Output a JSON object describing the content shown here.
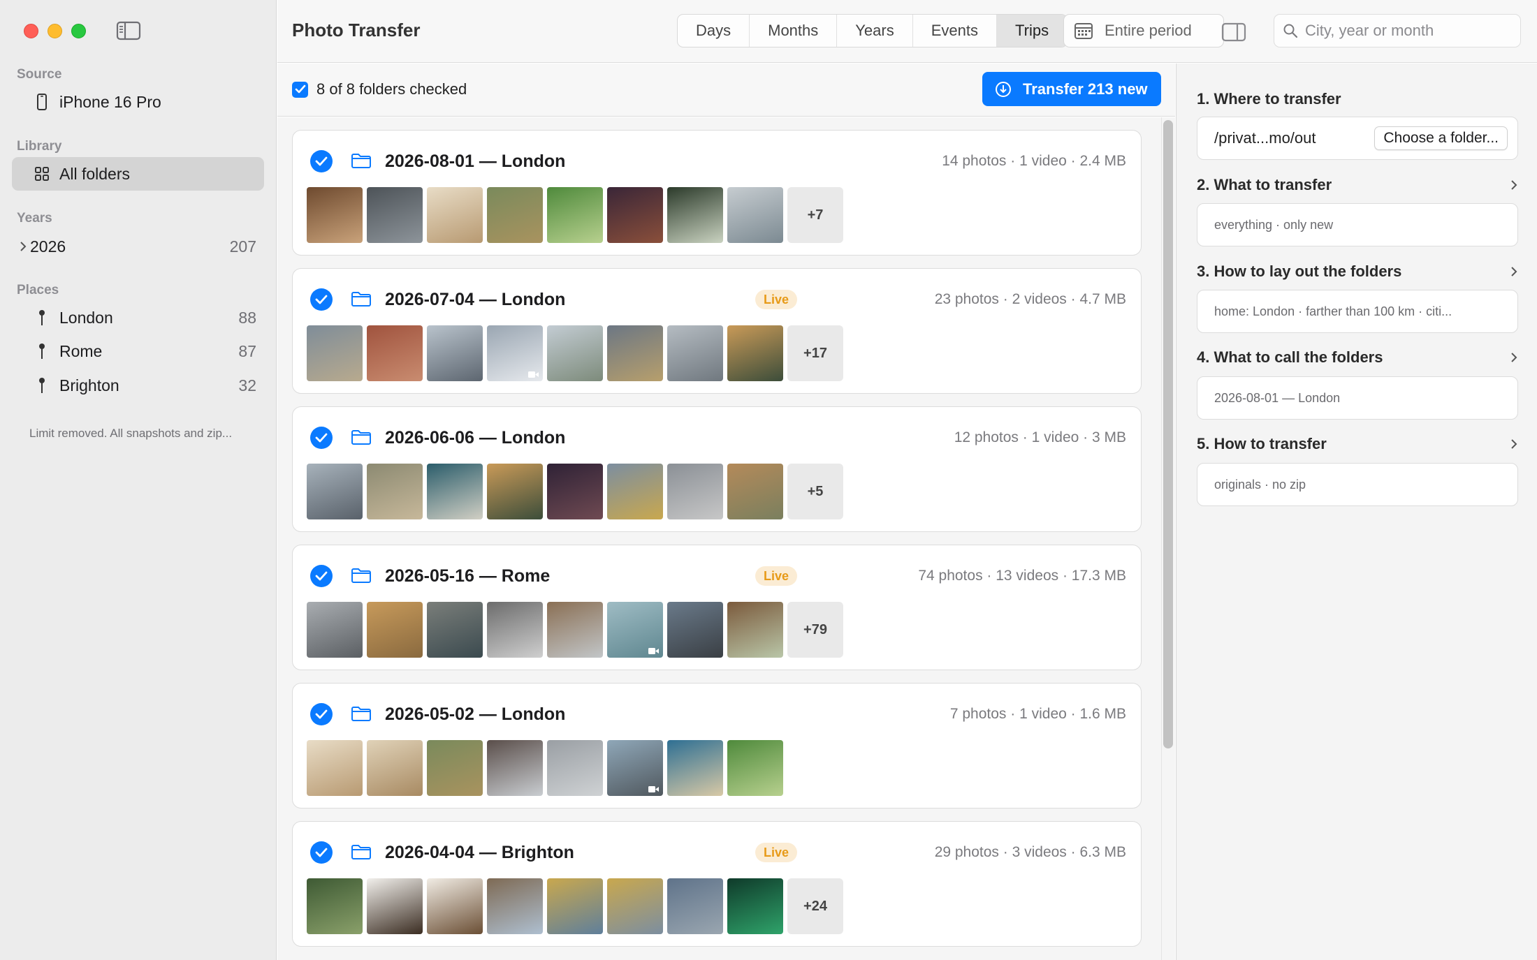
{
  "sidebar": {
    "source_header": "Source",
    "source_item": "iPhone 16 Pro",
    "library_header": "Library",
    "library_item": "All folders",
    "years_header": "Years",
    "year_item": {
      "label": "2026",
      "count": "207"
    },
    "places_header": "Places",
    "places": [
      {
        "label": "London",
        "count": "88"
      },
      {
        "label": "Rome",
        "count": "87"
      },
      {
        "label": "Brighton",
        "count": "32"
      }
    ],
    "note": "Limit removed. All snapshots and zip..."
  },
  "toolbar": {
    "title": "Photo Transfer",
    "tabs": [
      "Days",
      "Months",
      "Years",
      "Events",
      "Trips"
    ],
    "active_tab": "Trips",
    "period_label": "Entire period",
    "search_placeholder": "City, year or month"
  },
  "subbar": {
    "checked_label": "8 of 8 folders checked",
    "transfer_label": "Transfer 213 new"
  },
  "folders": [
    {
      "title": "2026-08-01 — London",
      "live": "",
      "meta": "14 photos · 1 video · 2.4 MB",
      "more": "+7",
      "thumbs": [
        [
          "#6e4a2f",
          "#c9a27a"
        ],
        [
          "#4d5358",
          "#8d949a"
        ],
        [
          "#e8dcc6",
          "#b89a72"
        ],
        [
          "#7a8a5c",
          "#a9935f"
        ],
        [
          "#4f8a3c",
          "#b7d08e"
        ],
        [
          "#3a2638",
          "#8a4f3a"
        ],
        [
          "#2b3a2a",
          "#c9d2c0"
        ],
        [
          "#c6ccd0",
          "#7c8a92"
        ]
      ],
      "video_index": -1
    },
    {
      "title": "2026-07-04 — London",
      "live": "Live",
      "meta": "23 photos · 2 videos · 4.7 MB",
      "more": "+17",
      "thumbs": [
        [
          "#7f8d99",
          "#b8aa8e"
        ],
        [
          "#a0533e",
          "#c98c70"
        ],
        [
          "#b9c3cc",
          "#5d6670"
        ],
        [
          "#9aa6b2",
          "#e6e9ed"
        ],
        [
          "#c3ccd3",
          "#7d8b7b"
        ],
        [
          "#6c7784",
          "#b79f6c"
        ],
        [
          "#b5bcc2",
          "#70787f"
        ],
        [
          "#c99a58",
          "#3c4d3a"
        ]
      ],
      "video_index": 3
    },
    {
      "title": "2026-06-06 — London",
      "live": "",
      "meta": "12 photos · 1 video · 3 MB",
      "more": "+5",
      "thumbs": [
        [
          "#a7b2bb",
          "#59616a"
        ],
        [
          "#8c8a72",
          "#c7b89a"
        ],
        [
          "#2b5d6b",
          "#d1cfc4"
        ],
        [
          "#c99a58",
          "#3c4d3a"
        ],
        [
          "#2f2236",
          "#6f4a52"
        ],
        [
          "#7c8ea0",
          "#c9a84e"
        ],
        [
          "#8b9096",
          "#c7c7c7"
        ],
        [
          "#b48a5a",
          "#7a7f5e"
        ]
      ],
      "video_index": -1
    },
    {
      "title": "2026-05-16 — Rome",
      "live": "Live",
      "meta": "74 photos · 13 videos · 17.3 MB",
      "more": "+79",
      "thumbs": [
        [
          "#a9adb1",
          "#5b5f63"
        ],
        [
          "#c79a5b",
          "#8a6a3f"
        ],
        [
          "#7a7e7a",
          "#3b4a4f"
        ],
        [
          "#6c6c6c",
          "#cfcfcf"
        ],
        [
          "#8a6f54",
          "#c2c6c8"
        ],
        [
          "#9fbcc4",
          "#5f8790"
        ],
        [
          "#6a7a8a",
          "#3a3f44"
        ],
        [
          "#7b5a3c",
          "#b9c6a8"
        ]
      ],
      "video_index": 5
    },
    {
      "title": "2026-05-02 — London",
      "live": "",
      "meta": "7 photos · 1 video · 1.6 MB",
      "more": "",
      "thumbs": [
        [
          "#e8dcc6",
          "#b89a72"
        ],
        [
          "#e0d2b8",
          "#a88a62"
        ],
        [
          "#7a8a5c",
          "#a9935f"
        ],
        [
          "#5a4e4a",
          "#c9cdd1"
        ],
        [
          "#9a9fa4",
          "#cfd2d4"
        ],
        [
          "#8fa7b8",
          "#50585e"
        ],
        [
          "#2e6f93",
          "#d8c9a6"
        ],
        [
          "#4f8a3c",
          "#b7d08e"
        ]
      ],
      "video_index": 5
    },
    {
      "title": "2026-04-04 — Brighton",
      "live": "Live",
      "meta": "29 photos · 3 videos · 6.3 MB",
      "more": "+24",
      "thumbs": [
        [
          "#3e5a34",
          "#8aa06a"
        ],
        [
          "#f2f0ec",
          "#3b2d22"
        ],
        [
          "#f1ece4",
          "#6b4f35"
        ],
        [
          "#7e6a54",
          "#aebfd0"
        ],
        [
          "#c9a84e",
          "#5f7f9b"
        ],
        [
          "#c9a84e",
          "#7c8ea0"
        ],
        [
          "#5f738a",
          "#9aa6b0"
        ],
        [
          "#0f3a2a",
          "#2fa36a"
        ]
      ],
      "video_index": -1
    }
  ],
  "inspector": {
    "steps": [
      {
        "heading": "1. Where to transfer",
        "value": "/privat...mo/out",
        "button": "Choose a folder..."
      },
      {
        "heading": "2. What to transfer",
        "value": "everything · only new"
      },
      {
        "heading": "3. How to lay out the folders",
        "value": "home: London · farther than 100 km · citi..."
      },
      {
        "heading": "4. What to call the folders",
        "value": "2026-08-01 — London"
      },
      {
        "heading": "5. How to transfer",
        "value": "originals · no zip"
      }
    ]
  },
  "colors": {
    "accent": "#0a7aff",
    "live_badge_bg": "#fbecd4",
    "live_badge_text": "#e79a18"
  }
}
